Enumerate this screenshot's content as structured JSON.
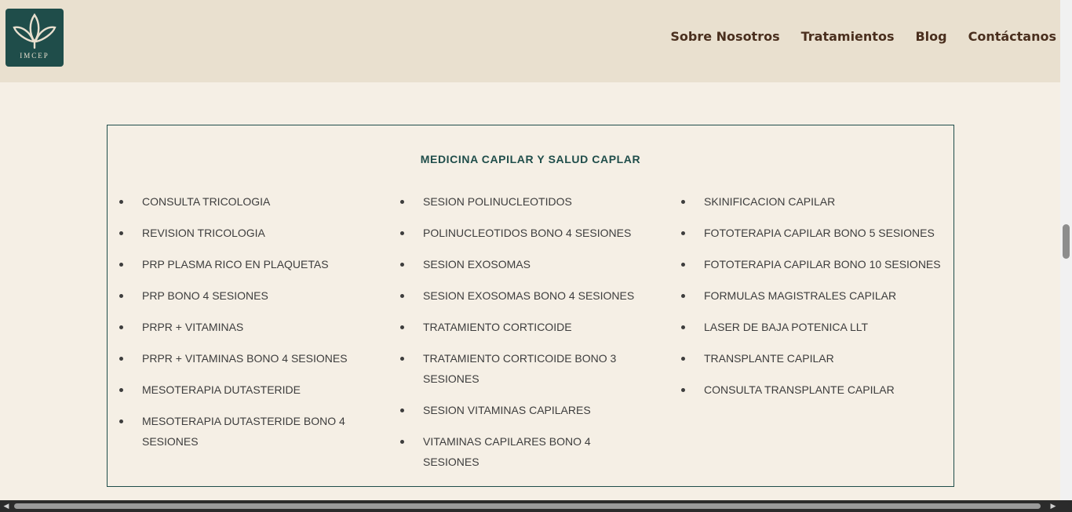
{
  "brand": {
    "logo_text": "IMCEP"
  },
  "nav": {
    "items": [
      "Sobre Nosotros",
      "Tratamientos",
      "Blog",
      "Contáctanos"
    ]
  },
  "panel": {
    "title": "MEDICINA CAPILAR Y SALUD CAPLAR",
    "columns": [
      [
        "CONSULTA TRICOLOGIA",
        "REVISION TRICOLOGIA",
        "PRP PLASMA RICO EN PLAQUETAS",
        "PRP BONO 4 SESIONES",
        "PRPR + VITAMINAS",
        "PRPR + VITAMINAS BONO 4 SESIONES",
        "MESOTERAPIA DUTASTERIDE",
        "MESOTERAPIA DUTASTERIDE BONO 4 SESIONES"
      ],
      [
        "SESION POLINUCLEOTIDOS",
        "POLINUCLEOTIDOS BONO 4 SESIONES",
        "SESION EXOSOMAS",
        "SESION EXOSOMAS BONO 4 SESIONES",
        "TRATAMIENTO CORTICOIDE",
        "TRATAMIENTO CORTICOIDE BONO 3 SESIONES",
        "SESION VITAMINAS CAPILARES",
        "VITAMINAS CAPILARES BONO 4 SESIONES"
      ],
      [
        "SKINIFICACION CAPILAR",
        "FOTOTERAPIA CAPILAR BONO 5 SESIONES",
        "FOTOTERAPIA CAPILAR BONO 10 SESIONES",
        "FORMULAS MAGISTRALES CAPILAR",
        "LASER DE BAJA POTENICA LLT",
        "TRANSPLANTE CAPILAR",
        "CONSULTA TRANSPLANTE CAPILAR"
      ]
    ]
  },
  "colors": {
    "brand": "#1f4d4a",
    "header_bg": "#e9e0cf",
    "page_bg": "#f5efe5",
    "nav_text": "#4a2f1e"
  },
  "icons": {
    "logo": "leaf-logo-icon",
    "scroll_left": "arrow-left-icon",
    "scroll_right": "arrow-right-icon"
  }
}
